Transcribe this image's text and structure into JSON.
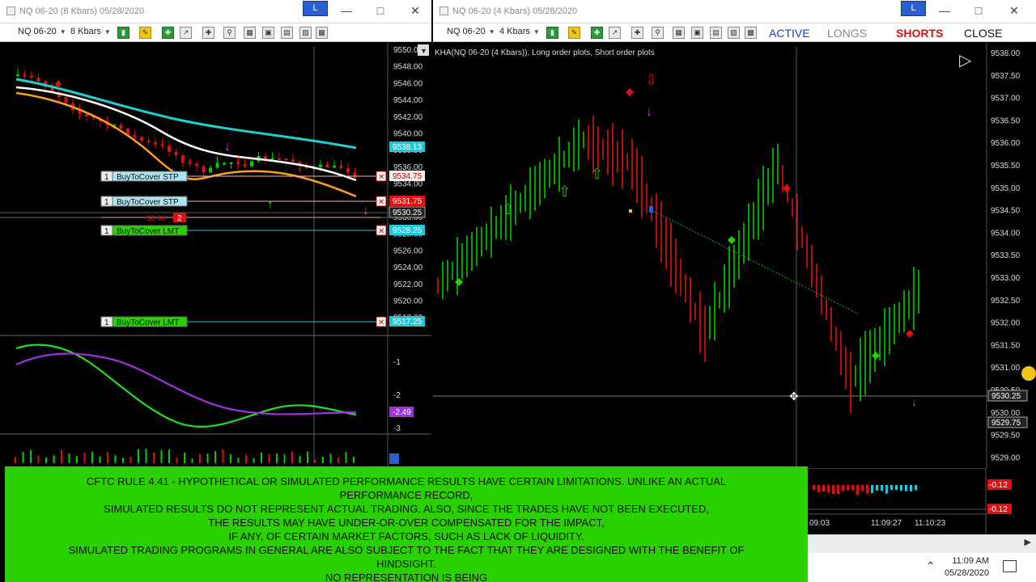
{
  "left_window": {
    "title": "NQ 06-20 (8 Kbars)  05/28/2020",
    "link_label": "L",
    "instrument": "NQ 06-20",
    "interval": "8 Kbars",
    "price_axis": [
      "9550.0",
      "9548.00",
      "9546.00",
      "9544.00",
      "9542.00",
      "9540.00",
      "9538.00",
      "9536.00",
      "9534.00",
      "9532.00",
      "9530.00",
      "9528.00",
      "9526.00",
      "9524.00",
      "9522.00",
      "9520.00",
      "9518.00"
    ],
    "price_tags": {
      "ema": "9538.13",
      "stp1": "9534.75",
      "stp2": "9531.75",
      "last": "9530.25",
      "lmt1": "9528.25",
      "lmt2": "9517.25"
    },
    "orders": [
      {
        "qty": "1",
        "label": "BuyToCover STP"
      },
      {
        "qty": "1",
        "label": "BuyToCover STP"
      },
      {
        "qty": "1",
        "label": "BuyToCover LMT"
      },
      {
        "qty": "1",
        "label": "BuyToCover LMT"
      }
    ],
    "position": {
      "pnl": "$0.00",
      "qty": "2"
    },
    "osc_axis": [
      "-1",
      "-2",
      "-3"
    ],
    "osc_tag": "-2.49"
  },
  "right_window": {
    "title": "NQ 06-20 (4 Kbars)  05/28/2020",
    "link_label": "L",
    "instrument": "NQ 06-20",
    "interval": "4 Kbars",
    "modes": {
      "active": "ACTIVE",
      "longs": "LONGS",
      "shorts": "SHORTS",
      "close": "CLOSE"
    },
    "chart_label": "KHA(NQ 06-20 (4 Kbars)), Long order plots, Short order plots",
    "price_axis": [
      "9538.00",
      "9537.50",
      "9537.00",
      "9536.50",
      "9536.00",
      "9535.50",
      "9535.00",
      "9534.50",
      "9534.00",
      "9533.50",
      "9533.00",
      "9532.50",
      "9532.00",
      "9531.50",
      "9531.00",
      "9530.50",
      "9530.00",
      "9529.50",
      "9529.00"
    ],
    "price_tags": {
      "last": "9530.25",
      "sell": "9529.75"
    },
    "osc_tags": [
      "-0.12",
      "-0.12"
    ],
    "time_axis": [
      "09:03",
      "11:09:27",
      "11:10:23"
    ]
  },
  "disclaimer": [
    "CFTC RULE 4.41 - HYPOTHETICAL OR SIMULATED PERFORMANCE RESULTS HAVE CERTAIN LIMITATIONS. UNLIKE AN ACTUAL",
    "PERFORMANCE RECORD,",
    "SIMULATED RESULTS DO NOT REPRESENT ACTUAL TRADING. ALSO, SINCE THE TRADES HAVE NOT BEEN EXECUTED,",
    "THE RESULTS MAY HAVE UNDER-OR-OVER COMPENSATED FOR THE IMPACT,",
    "IF ANY, OF CERTAIN MARKET FACTORS, SUCH AS LACK OF LIQUIDITY.",
    "SIMULATED TRADING PROGRAMS IN GENERAL ARE ALSO SUBJECT TO THE FACT THAT THEY ARE DESIGNED WITH THE BENEFIT OF",
    "HINDSIGHT.",
    "NO REPRESENTATION IS BEING"
  ],
  "taskbar": {
    "time": "11:09 AM",
    "date": "05/28/2020"
  },
  "colors": {
    "up": "#00d000",
    "down": "#e01010",
    "ema_fast": "#ffffff",
    "ema_mid": "#ffa020",
    "ema_slow": "#20d0d0",
    "disclaimer_bg": "#2ad100",
    "active_blue": "#1a3bd0",
    "shorts_red": "#e01010"
  }
}
